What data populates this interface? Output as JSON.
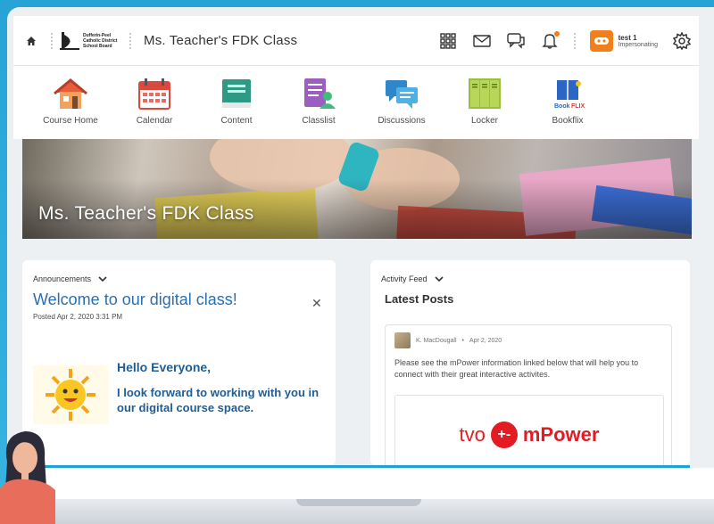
{
  "header": {
    "school_logo_text": "Dufferin-Peel Catholic District School Board",
    "course_title": "Ms. Teacher's FDK Class",
    "user": {
      "name": "test 1",
      "status": "Impersonating"
    }
  },
  "nav": {
    "items": [
      {
        "label": "Course Home",
        "icon": "house-icon"
      },
      {
        "label": "Calendar",
        "icon": "calendar-icon"
      },
      {
        "label": "Content",
        "icon": "book-icon"
      },
      {
        "label": "Classlist",
        "icon": "classlist-icon"
      },
      {
        "label": "Discussions",
        "icon": "discussion-bubbles-icon"
      },
      {
        "label": "Locker",
        "icon": "locker-icon"
      },
      {
        "label": "Bookflix",
        "icon": "bookflix-icon"
      }
    ]
  },
  "banner": {
    "title": "Ms. Teacher's FDK Class"
  },
  "announcements": {
    "widget_title": "Announcements",
    "title": "Welcome to our digital class!",
    "posted": "Posted Apr 2, 2020 3:31 PM",
    "hello": "Hello Everyone,",
    "body": "I look forward to working with you in our digital course space."
  },
  "activity": {
    "widget_title": "Activity Feed",
    "latest_heading": "Latest Posts",
    "post": {
      "author": "K. MacDougall",
      "date": "Apr 2, 2020",
      "text": "Please see the mPower information linked below that will help you to connect with their great interactive activites."
    },
    "logo": {
      "left": "tvo",
      "right": "mPower"
    }
  },
  "colors": {
    "accent_blue": "#2a6fb0",
    "background_blue": "#2aa8d8",
    "avatar_orange": "#f07f1c",
    "mpower_red": "#e31b23"
  }
}
